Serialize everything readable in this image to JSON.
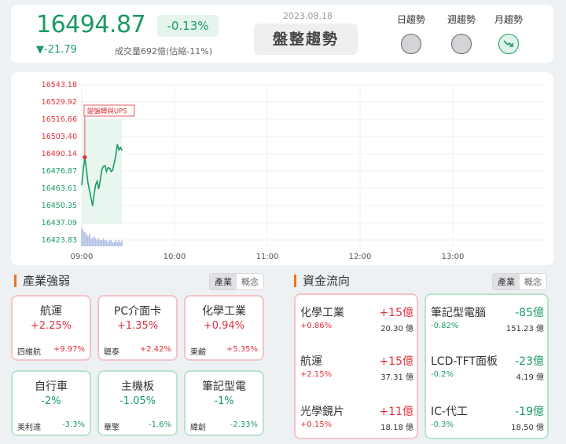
{
  "index": {
    "value": "16494.87",
    "change_pct": "-0.13%",
    "change": "▼-21.79",
    "volume": "成交量692億(估縮-11%)"
  },
  "trend": {
    "date": "2023.08.18",
    "status": "盤整趨勢",
    "columns": [
      {
        "label": "日趨勢",
        "state": "neutral"
      },
      {
        "label": "週趨勢",
        "state": "neutral"
      },
      {
        "label": "月趨勢",
        "state": "down"
      }
    ]
  },
  "colors": {
    "up": "#e0323c",
    "down": "#1a9b62",
    "accent": "#ee7422"
  },
  "chart_data": {
    "type": "line",
    "y_ticks": [
      "16543.18",
      "16529.92",
      "16516.66",
      "16503.40",
      "16490.14",
      "16476.87",
      "16463.61",
      "16450.35",
      "16437.09",
      "16423.83"
    ],
    "x_ticks": [
      "09:00",
      "10:00",
      "11:00",
      "12:00",
      "13:00"
    ],
    "ylim": [
      16423.83,
      16543.18
    ],
    "x_range_minutes": [
      0,
      270
    ],
    "annotation": "變盤轉與UPS",
    "series": [
      {
        "x": [
          0,
          1,
          2,
          3,
          4,
          5,
          6,
          7,
          8,
          9,
          10,
          11,
          12,
          13,
          14,
          15,
          16,
          17,
          18,
          19,
          20,
          21,
          22,
          23,
          24,
          25,
          26
        ],
        "y": [
          16466.0,
          16478.0,
          16487.5,
          16478.0,
          16468.0,
          16462.0,
          16456.0,
          16450.0,
          16459.0,
          16466.5,
          16469.0,
          16463.0,
          16470.0,
          16478.0,
          16480.5,
          16481.0,
          16476.5,
          16479.5,
          16479.0,
          16476.5,
          16477.5,
          16483.0,
          16488.5,
          16497.5,
          16493.0,
          16495.0,
          16492.5
        ]
      }
    ],
    "volume": [
      9,
      8,
      7,
      6,
      5,
      6,
      4,
      4,
      5,
      4,
      3,
      4,
      3,
      3,
      4,
      3,
      3,
      2,
      3,
      3,
      2,
      2,
      3,
      2,
      3,
      2,
      3
    ]
  },
  "industry_strength": {
    "title": "產業強弱",
    "toggle": [
      "產業",
      "概念"
    ],
    "cards": [
      {
        "name": "航運",
        "pct": "+2.25%",
        "stock": "四維航",
        "stock_pct": "+9.97%",
        "dir": "up"
      },
      {
        "name": "PC介面卡",
        "pct": "+1.35%",
        "stock": "聰泰",
        "stock_pct": "+2.42%",
        "dir": "up"
      },
      {
        "name": "化學工業",
        "pct": "+0.94%",
        "stock": "東鹼",
        "stock_pct": "+5.35%",
        "dir": "up"
      },
      {
        "name": "自行車",
        "pct": "-2%",
        "stock": "美利達",
        "stock_pct": "-3.3%",
        "dir": "down"
      },
      {
        "name": "主機板",
        "pct": "-1.05%",
        "stock": "華擎",
        "stock_pct": "-1.6%",
        "dir": "down"
      },
      {
        "name": "筆記型電",
        "pct": "-1%",
        "stock": "緯創",
        "stock_pct": "-2.33%",
        "dir": "down"
      }
    ]
  },
  "fund_flow": {
    "title": "資金流向",
    "toggle": [
      "產業",
      "概念"
    ],
    "inflow": [
      {
        "name": "化學工業",
        "flow": "+15億",
        "pct": "+0.86%",
        "volume": "20.30 億"
      },
      {
        "name": "航運",
        "flow": "+15億",
        "pct": "+2.15%",
        "volume": "37.31 億"
      },
      {
        "name": "光學鏡片",
        "flow": "+11億",
        "pct": "+0.15%",
        "volume": "18.18 億"
      }
    ],
    "outflow": [
      {
        "name": "筆記型電腦",
        "flow": "-85億",
        "pct": "-0.82%",
        "volume": "151.23 億"
      },
      {
        "name": "LCD-TFT面板",
        "flow": "-23億",
        "pct": "-0.2%",
        "volume": "4.19 億"
      },
      {
        "name": "IC-代工",
        "flow": "-19億",
        "pct": "-0.3%",
        "volume": "18.50 億"
      }
    ]
  }
}
